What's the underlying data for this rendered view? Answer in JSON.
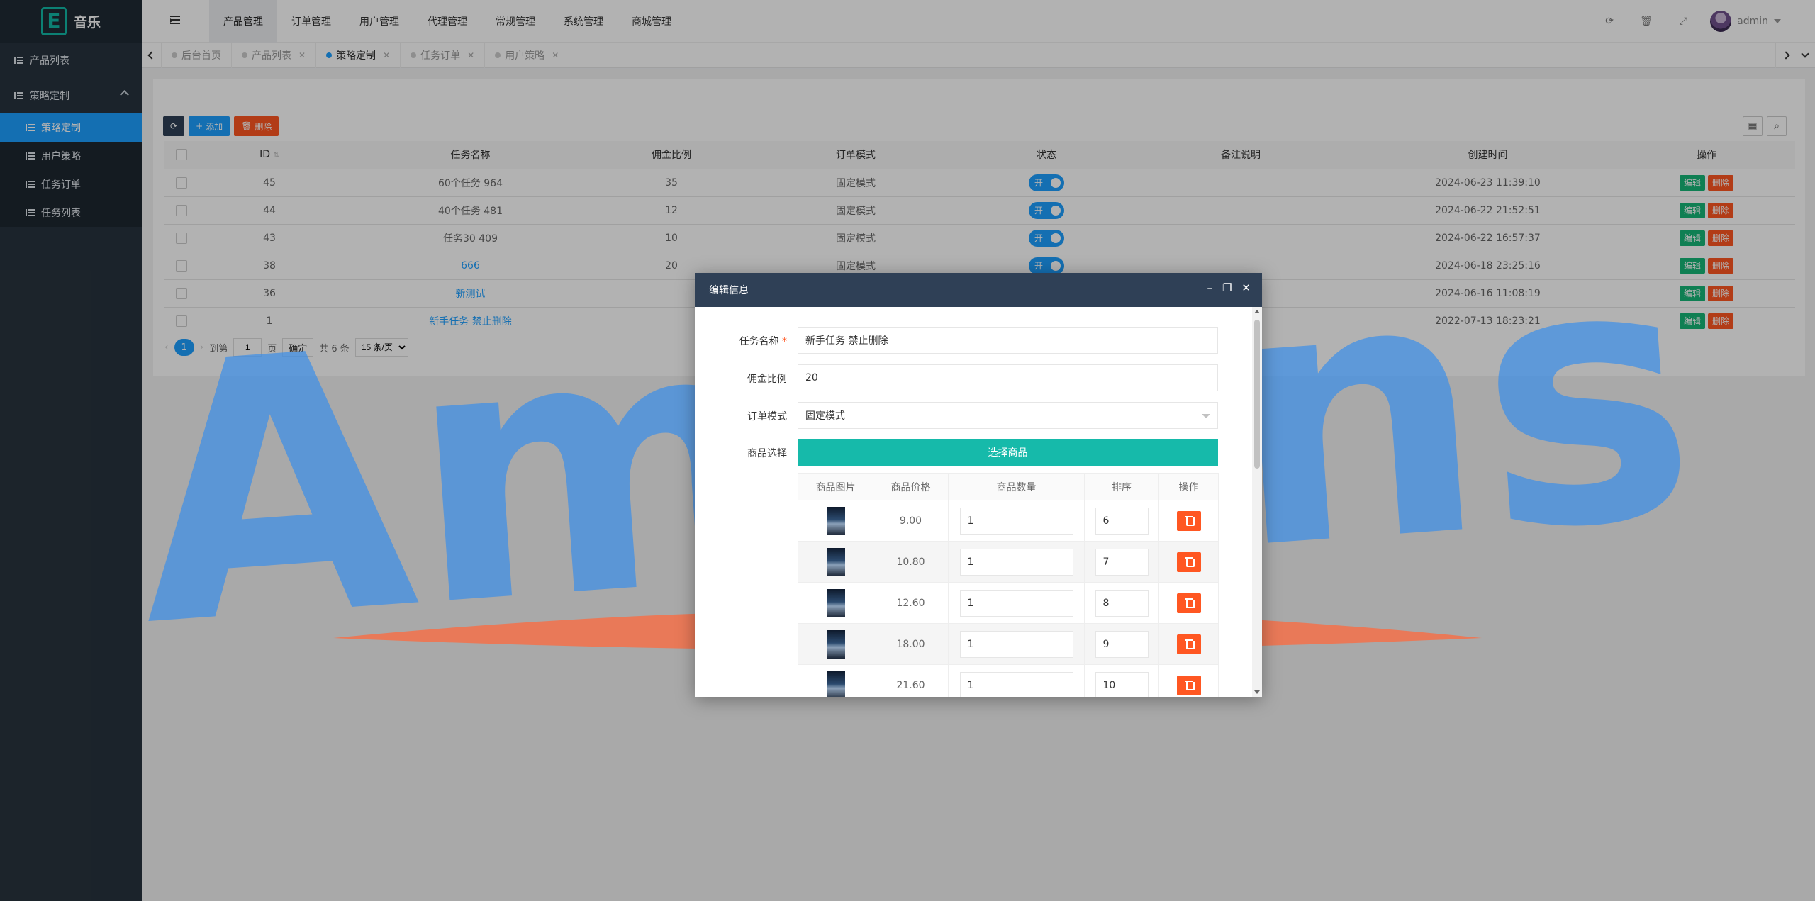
{
  "app": {
    "logo_letter": "E",
    "name": "音乐"
  },
  "sidebar": {
    "items": [
      {
        "label": "产品列表"
      },
      {
        "label": "策略定制",
        "expanded": true
      }
    ],
    "sub_items": [
      {
        "label": "策略定制",
        "active": true
      },
      {
        "label": "用户策略"
      },
      {
        "label": "任务订单"
      },
      {
        "label": "任务列表"
      }
    ]
  },
  "topbar": {
    "nav": [
      {
        "label": "产品管理",
        "active": true
      },
      {
        "label": "订单管理"
      },
      {
        "label": "用户管理"
      },
      {
        "label": "代理管理"
      },
      {
        "label": "常规管理"
      },
      {
        "label": "系统管理"
      },
      {
        "label": "商城管理"
      }
    ],
    "user": "admin"
  },
  "tabs": [
    {
      "label": "后台首页",
      "closable": false
    },
    {
      "label": "产品列表",
      "closable": true
    },
    {
      "label": "策略定制",
      "closable": true,
      "active": true
    },
    {
      "label": "任务订单",
      "closable": true
    },
    {
      "label": "用户策略",
      "closable": true
    }
  ],
  "toolbar": {
    "add_label": "添加",
    "delete_label": "删除"
  },
  "table": {
    "columns": [
      "ID",
      "任务名称",
      "佣金比例",
      "订单模式",
      "状态",
      "备注说明",
      "创建时间",
      "操作"
    ],
    "rows": [
      {
        "id": "45",
        "name": "60个任务 964",
        "commission": "35",
        "mode": "固定模式",
        "status": "开",
        "note": "",
        "created": "2024-06-23 11:39:10"
      },
      {
        "id": "44",
        "name": "40个任务 481",
        "commission": "12",
        "mode": "固定模式",
        "status": "开",
        "note": "",
        "created": "2024-06-22 21:52:51"
      },
      {
        "id": "43",
        "name": "任务30 409",
        "commission": "10",
        "mode": "固定模式",
        "status": "开",
        "note": "",
        "created": "2024-06-22 16:57:37"
      },
      {
        "id": "38",
        "name": "666",
        "commission": "20",
        "mode": "固定模式",
        "status": "开",
        "note": "",
        "created": "2024-06-18 23:25:16"
      },
      {
        "id": "36",
        "name": "新测试",
        "commission": "",
        "mode": "",
        "status": "",
        "note": "",
        "created": "2024-06-16 11:08:19"
      },
      {
        "id": "1",
        "name": "新手任务 禁止删除",
        "commission": "",
        "mode": "",
        "status": "",
        "note": "",
        "created": "2022-07-13 18:23:21"
      }
    ],
    "edit_label": "编辑",
    "del_label": "删除"
  },
  "pager": {
    "current": "1",
    "goto_label": "到第",
    "page_value": "1",
    "page_unit": "页",
    "confirm": "确定",
    "total": "共 6 条",
    "page_size": "15 条/页"
  },
  "modal": {
    "title": "编辑信息",
    "fields": {
      "name_label": "任务名称",
      "name_value": "新手任务 禁止删除",
      "commission_label": "佣金比例",
      "commission_value": "20",
      "mode_label": "订单模式",
      "mode_value": "固定模式",
      "goods_label": "商品选择",
      "select_goods": "选择商品"
    },
    "goods_columns": [
      "商品图片",
      "商品价格",
      "商品数量",
      "排序",
      "操作"
    ],
    "goods": [
      {
        "price": "9.00",
        "qty": "1",
        "sort": "6"
      },
      {
        "price": "10.80",
        "qty": "1",
        "sort": "7"
      },
      {
        "price": "12.60",
        "qty": "1",
        "sort": "8"
      },
      {
        "price": "18.00",
        "qty": "1",
        "sort": "9"
      },
      {
        "price": "21.60",
        "qty": "1",
        "sort": "10"
      }
    ]
  },
  "watermark": {
    "text": "Amasns",
    "color": "#3d8fe8",
    "accent": "#ff6a3d"
  }
}
